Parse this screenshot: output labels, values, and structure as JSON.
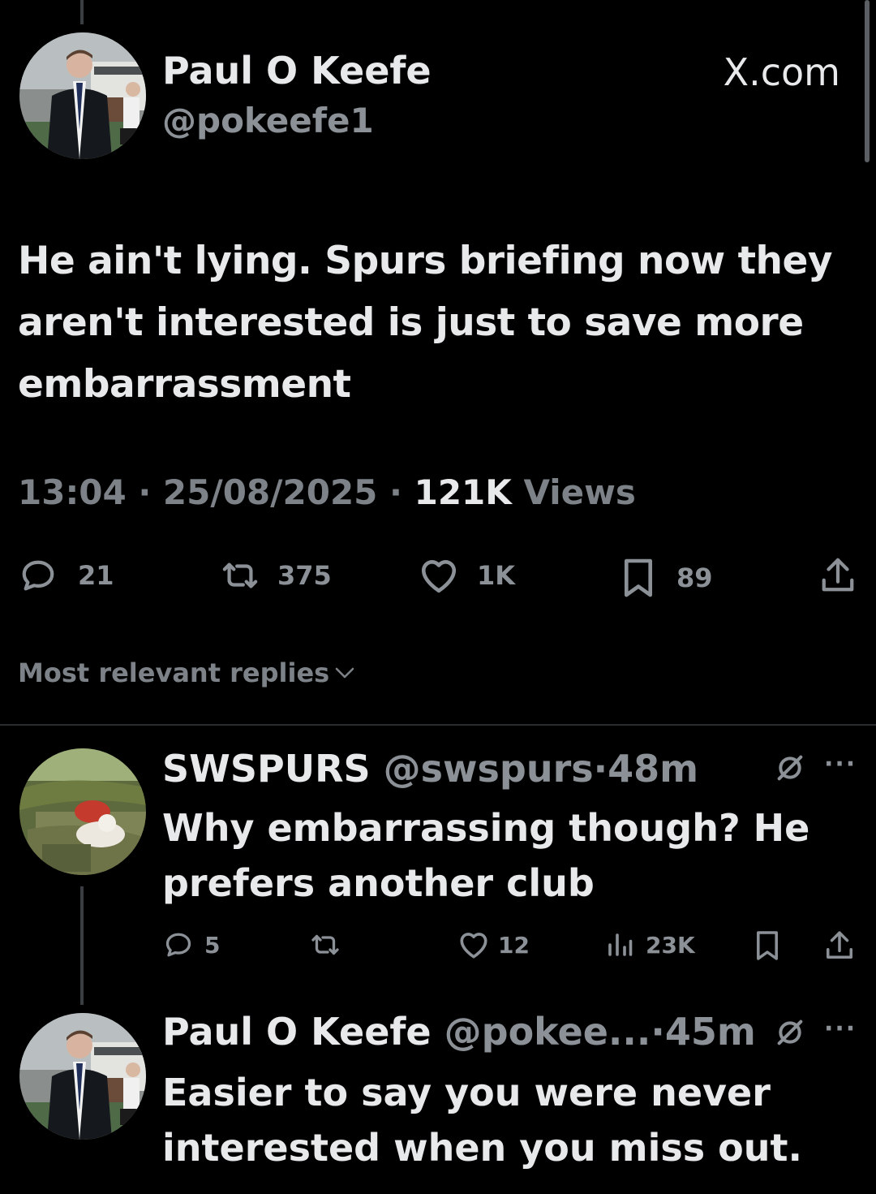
{
  "main_tweet": {
    "author_name": "Paul O Keefe",
    "handle": "@pokeefe1",
    "brand": "X.com",
    "text": "He ain't lying. Spurs briefing now they aren't interested is just to save more embarrassment",
    "time": "13:04",
    "date": "25/08/2025",
    "views_count": "121K",
    "views_label": "Views",
    "sep": "·",
    "replies": "21",
    "reposts": "375",
    "likes": "1K",
    "bookmarks": "89"
  },
  "sort_label": "Most relevant replies",
  "replies": [
    {
      "author_name": "SWSPURS",
      "handle": "@swspurs",
      "time": "48m",
      "sep": "·",
      "text": "Why embarrassing though? He prefers another club",
      "replies": "5",
      "likes": "12",
      "views": "23K"
    },
    {
      "author_name": "Paul O Keefe",
      "handle": "@pokee...",
      "time": "45m",
      "sep": "·",
      "text": "Easier to say you were never interested when you miss out."
    }
  ],
  "icons": {
    "reply": "speech-bubble-icon",
    "repost": "repost-arrows-icon",
    "like": "heart-icon",
    "bookmark": "bookmark-icon",
    "share": "share-icon",
    "views": "bar-chart-icon",
    "grok": "grok-icon",
    "more": "more-dots-icon"
  },
  "colors": {
    "background": "#000000",
    "text": "#e7e9ea",
    "muted": "#8b9197"
  }
}
